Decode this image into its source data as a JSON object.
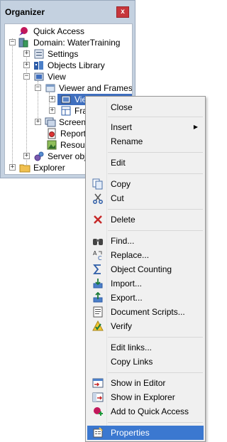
{
  "organizer": {
    "title": "Organizer",
    "close_glyph": "x",
    "tree": [
      {
        "label": "Quick Access",
        "icon": "quick-access-icon"
      },
      {
        "label": "Domain: WaterTraining",
        "icon": "domain-icon"
      },
      {
        "label": "Settings",
        "icon": "settings-icon"
      },
      {
        "label": "Objects Library",
        "icon": "objects-library-icon"
      },
      {
        "label": "View",
        "icon": "view-icon"
      },
      {
        "label": "Viewer and Frames",
        "icon": "folder-icon"
      },
      {
        "label": "View",
        "icon": "view-icon"
      },
      {
        "label": "Fram",
        "icon": "frame-icon"
      },
      {
        "label": "Screens",
        "icon": "screens-icon"
      },
      {
        "label": "Reports",
        "icon": "reports-icon"
      },
      {
        "label": "Resource",
        "icon": "resources-icon"
      },
      {
        "label": "Server objec",
        "icon": "server-objects-icon"
      },
      {
        "label": "Explorer",
        "icon": "folder-icon"
      }
    ]
  },
  "context_menu": {
    "items": [
      {
        "label": "Close",
        "icon": ""
      },
      {
        "label": "Insert",
        "icon": "",
        "submenu_arrow": "▶"
      },
      {
        "label": "Rename",
        "icon": ""
      },
      {
        "label": "Edit",
        "icon": ""
      },
      {
        "label": "Copy",
        "icon": "copy-icon"
      },
      {
        "label": "Cut",
        "icon": "cut-icon"
      },
      {
        "label": "Delete",
        "icon": "delete-icon"
      },
      {
        "label": "Find...",
        "icon": "find-icon"
      },
      {
        "label": "Replace...",
        "icon": "replace-icon"
      },
      {
        "label": "Object Counting",
        "icon": "sigma-icon"
      },
      {
        "label": "Import...",
        "icon": "import-icon"
      },
      {
        "label": "Export...",
        "icon": "export-icon"
      },
      {
        "label": "Document Scripts...",
        "icon": "document-scripts-icon"
      },
      {
        "label": "Verify",
        "icon": "verify-icon"
      },
      {
        "label": "Edit links...",
        "icon": ""
      },
      {
        "label": "Copy Links",
        "icon": ""
      },
      {
        "label": "Show in Editor",
        "icon": "show-in-editor-icon"
      },
      {
        "label": "Show in Explorer",
        "icon": "show-in-explorer-icon"
      },
      {
        "label": "Add to Quick Access",
        "icon": "add-quick-access-icon"
      },
      {
        "label": "Properties",
        "icon": "properties-icon"
      }
    ]
  },
  "colors": {
    "panel_bg": "#c4d1e0",
    "close_red": "#c7363b",
    "selection_blue": "#3f6fbf",
    "menu_highlight": "#3b78d0"
  }
}
